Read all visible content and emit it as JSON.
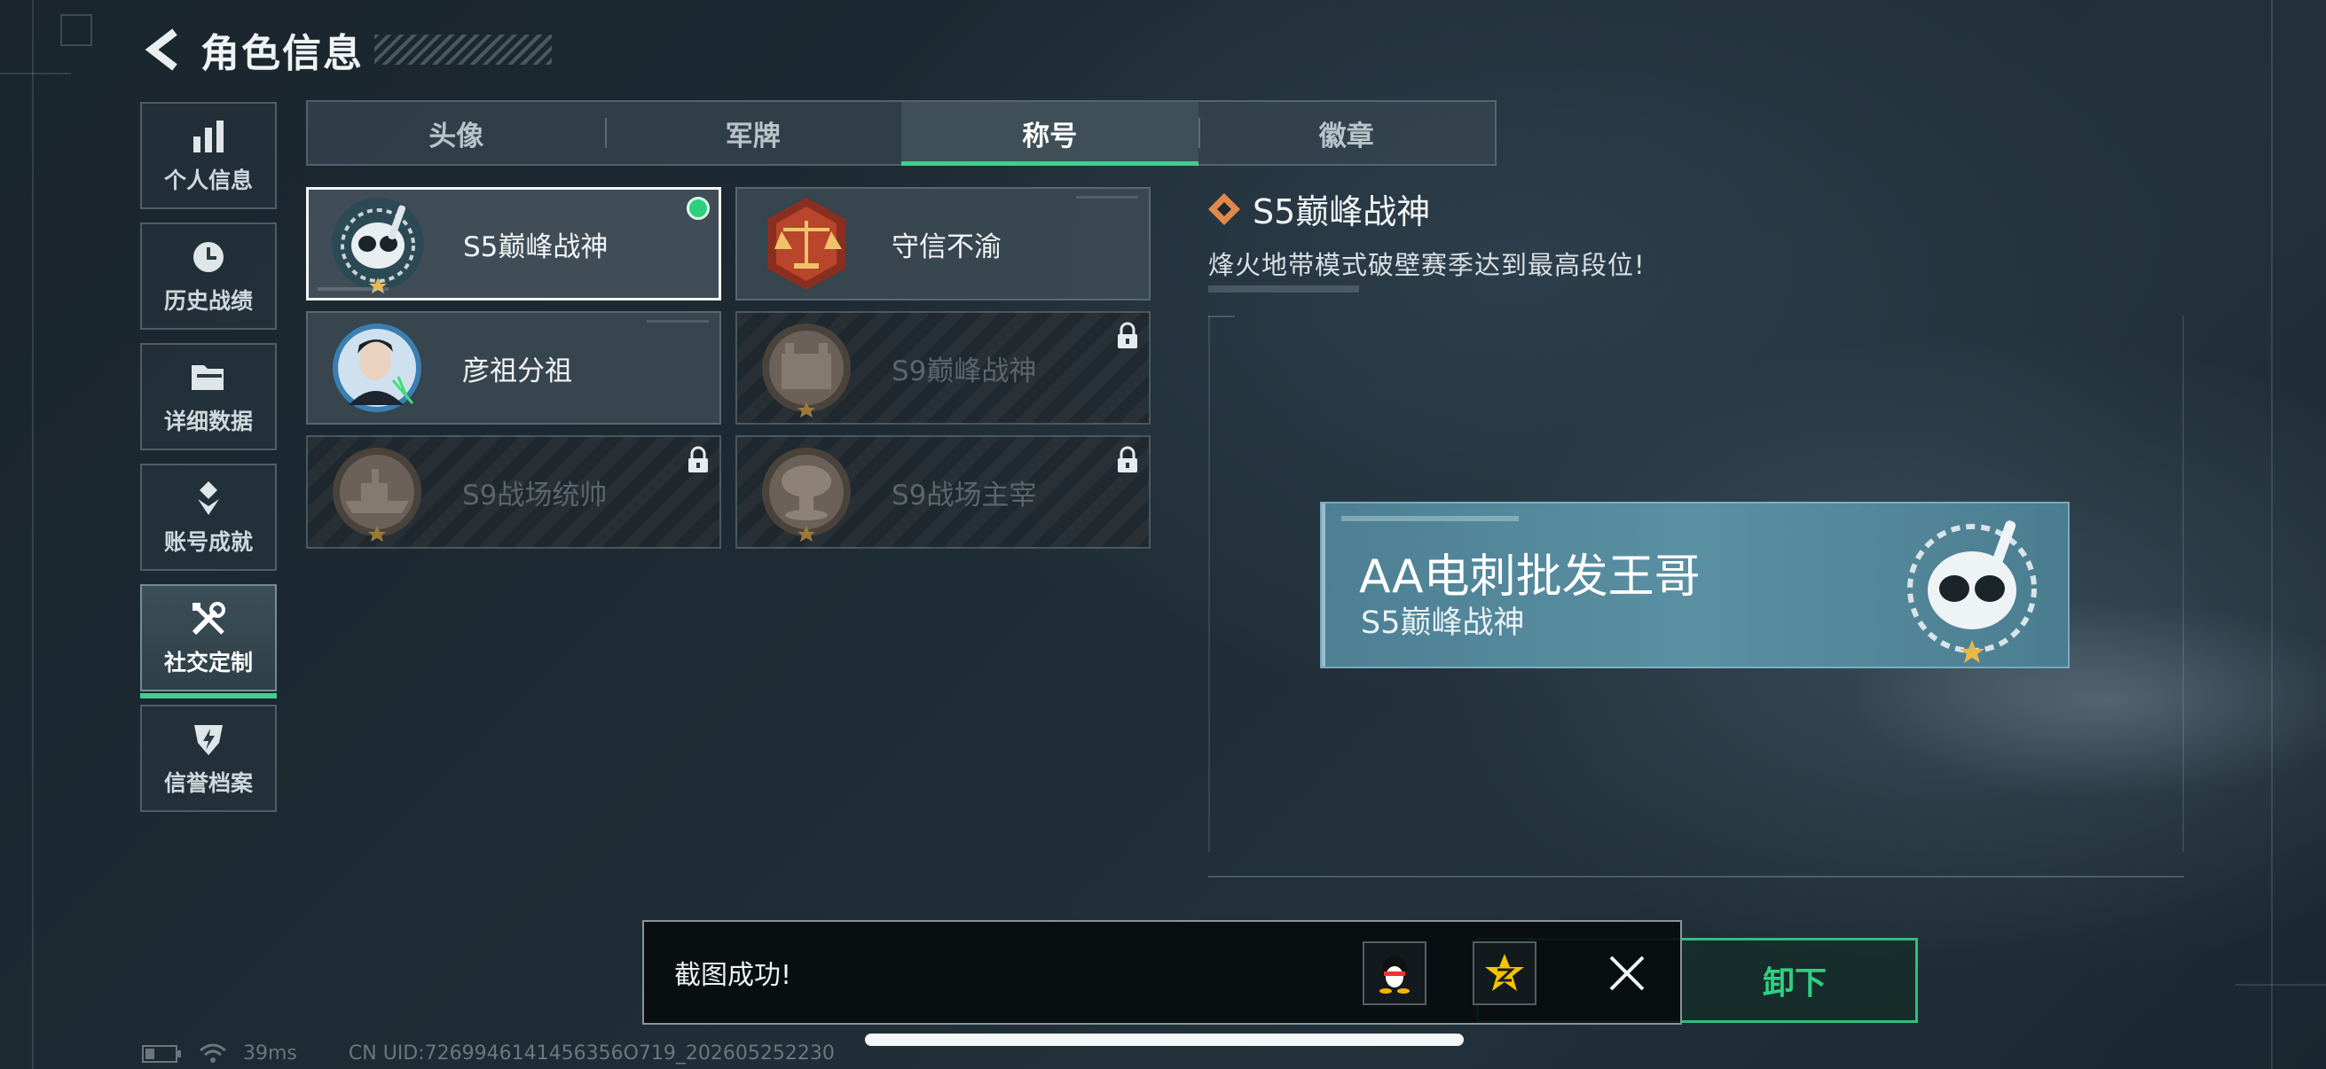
{
  "header": {
    "title": "角色信息"
  },
  "sidebar": {
    "items": [
      {
        "label": "个人信息",
        "icon": "bar-chart-icon"
      },
      {
        "label": "历史战绩",
        "icon": "history-clock-icon"
      },
      {
        "label": "详细数据",
        "icon": "folder-icon"
      },
      {
        "label": "账号成就",
        "icon": "medal-icon"
      },
      {
        "label": "社交定制",
        "icon": "wrench-tools-icon",
        "active": true
      },
      {
        "label": "信誉档案",
        "icon": "shield-bolt-icon"
      }
    ]
  },
  "tabs": [
    {
      "label": "头像"
    },
    {
      "label": "军牌"
    },
    {
      "label": "称号",
      "active": true
    },
    {
      "label": "徽章"
    }
  ],
  "titles": [
    {
      "label": "S5巅峰战神",
      "emblem": "diving-mask-emblem-icon",
      "selected": true,
      "equipped": true,
      "locked": false
    },
    {
      "label": "守信不渝",
      "emblem": "scales-emblem-icon",
      "selected": false,
      "equipped": false,
      "locked": false
    },
    {
      "label": "彦祖分祖",
      "emblem": "portrait-emblem-icon",
      "selected": false,
      "equipped": false,
      "locked": false
    },
    {
      "label": "S9巅峰战神",
      "emblem": "fortress-emblem-icon",
      "selected": false,
      "equipped": false,
      "locked": true
    },
    {
      "label": "S9战场统帅",
      "emblem": "battleship-emblem-icon",
      "selected": false,
      "equipped": false,
      "locked": true
    },
    {
      "label": "S9战场主宰",
      "emblem": "mushroom-cloud-emblem-icon",
      "selected": false,
      "equipped": false,
      "locked": true
    }
  ],
  "detail": {
    "title": "S5巅峰战神",
    "description": "烽火地带模式破壁赛季达到最高段位!"
  },
  "nameplate": {
    "player_name": "AA电刺批发王哥",
    "title": "S5巅峰战神"
  },
  "actions": {
    "unequip_label": "卸下"
  },
  "toast": {
    "message": "截图成功!"
  },
  "status": {
    "ping": "39ms",
    "uid": "CN UID:7269946141456356O719_202605252230"
  },
  "colors": {
    "accent": "#3fcf8e",
    "equipped_dot": "#2fcf7d",
    "nameplate": "#5a90a3",
    "title_diamond": "#e0894a"
  }
}
